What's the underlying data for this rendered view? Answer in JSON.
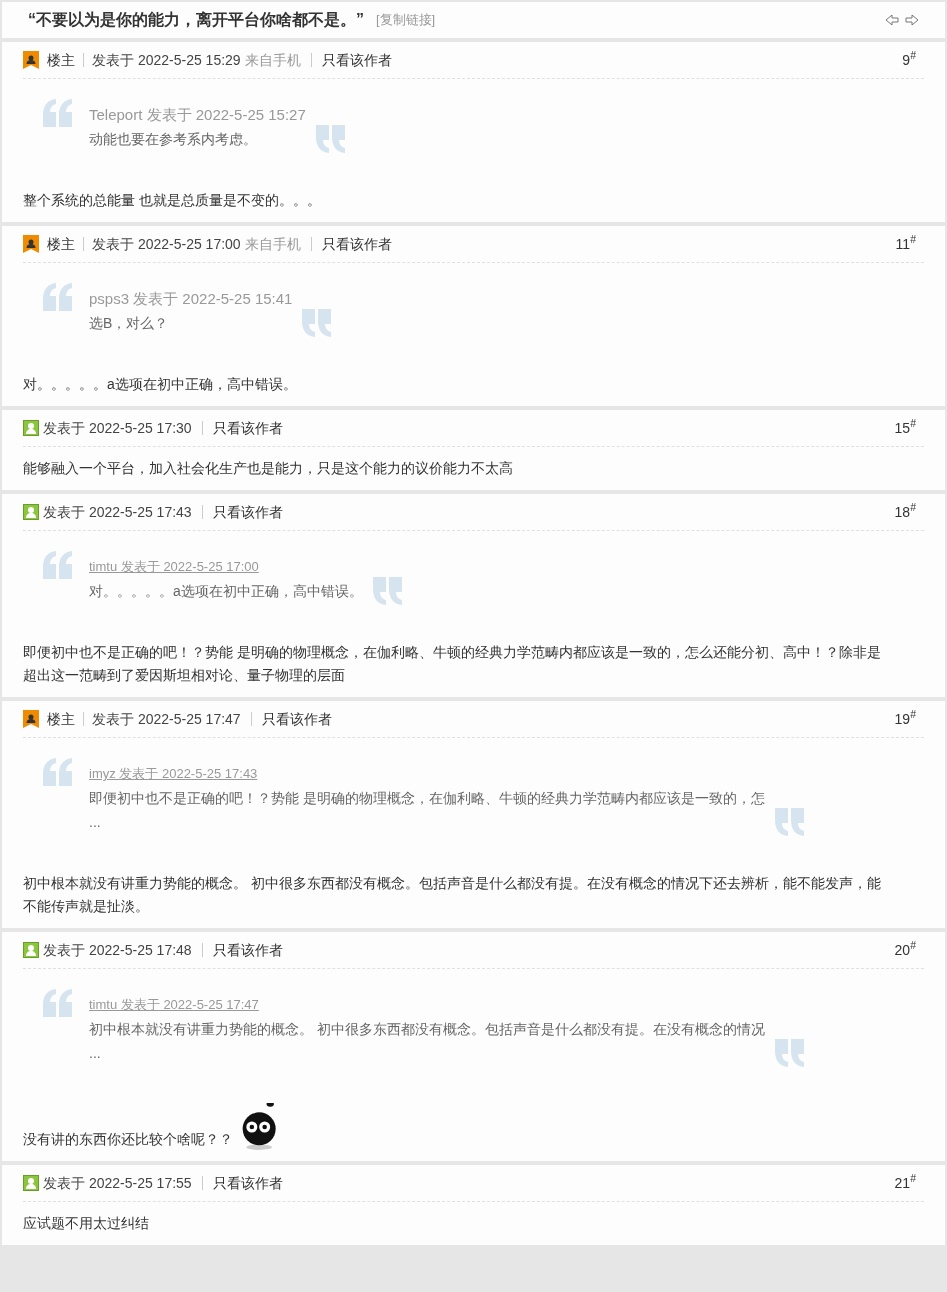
{
  "thread": {
    "title": "“不要以为是你的能力，离开平台你啥都不是。”",
    "copy_link": "[复制链接]"
  },
  "posts": [
    {
      "is_op": true,
      "op_label": "楼主",
      "posted": "发表于 2022-5-25 15:29",
      "mobile": "来自手机",
      "author_only": "只看该作者",
      "floor": "9$^{#}$",
      "quote": {
        "byline": "Teleport 发表于 2022-5-25 15:27",
        "linked": false,
        "lines": [
          "动能也要在参考系内考虑。"
        ]
      },
      "body": "整个系统的总能量 也就是总质量是不变的。。。"
    },
    {
      "is_op": true,
      "op_label": "楼主",
      "posted": "发表于 2022-5-25 17:00",
      "mobile": "来自手机",
      "author_only": "只看该作者",
      "floor": "11$^{#}$",
      "quote": {
        "byline": "psps3 发表于 2022-5-25 15:41",
        "linked": false,
        "lines": [
          "选B，对么？"
        ]
      },
      "body": "对。。。。。a选项在初中正确，高中错误。"
    },
    {
      "is_op": false,
      "posted": "发表于 2022-5-25 17:30",
      "author_only": "只看该作者",
      "floor": "15$^{#}$",
      "body": "能够融入一个平台，加入社会化生产也是能力，只是这个能力的议价能力不太高"
    },
    {
      "is_op": false,
      "posted": "发表于 2022-5-25 17:43",
      "author_only": "只看该作者",
      "floor": "18$^{#}$",
      "quote": {
        "byline": "timtu 发表于 2022-5-25 17:00",
        "linked": true,
        "lines": [
          "对。。。。。a选项在初中正确，高中错误。"
        ]
      },
      "body": "即便初中也不是正确的吧！？势能 是明确的物理概念，在伽利略、牛顿的经典力学范畴内都应该是一致的，怎么还能分初、高中！？除非是超出这一范畴到了爱因斯坦相对论、量子物理的层面"
    },
    {
      "is_op": true,
      "op_label": "楼主",
      "posted": "发表于 2022-5-25 17:47",
      "author_only": "只看该作者",
      "floor": "19$^{#}$",
      "quote": {
        "byline": "imyz 发表于 2022-5-25 17:43",
        "linked": true,
        "lines": [
          "即便初中也不是正确的吧！？势能 是明确的物理概念，在伽利略、牛顿的经典力学范畴内都应该是一致的，怎",
          "..."
        ]
      },
      "body": "初中根本就没有讲重力势能的概念。 初中很多东西都没有概念。包括声音是什么都没有提。在没有概念的情况下还去辨析，能不能发声，能不能传声就是扯淡。"
    },
    {
      "is_op": false,
      "posted": "发表于 2022-5-25 17:48",
      "author_only": "只看该作者",
      "floor": "20$^{#}$",
      "quote": {
        "byline": "timtu 发表于 2022-5-25 17:47",
        "linked": true,
        "lines": [
          "初中根本就没有讲重力势能的概念。 初中很多东西都没有概念。包括声音是什么都没有提。在没有概念的情况",
          "..."
        ]
      },
      "body": "没有讲的东西你还比较个啥呢？？",
      "emoticon": true
    },
    {
      "is_op": false,
      "posted": "发表于 2022-5-25 17:55",
      "author_only": "只看该作者",
      "floor": "21$^{#}$",
      "body": "应试题不用太过纠结"
    }
  ]
}
